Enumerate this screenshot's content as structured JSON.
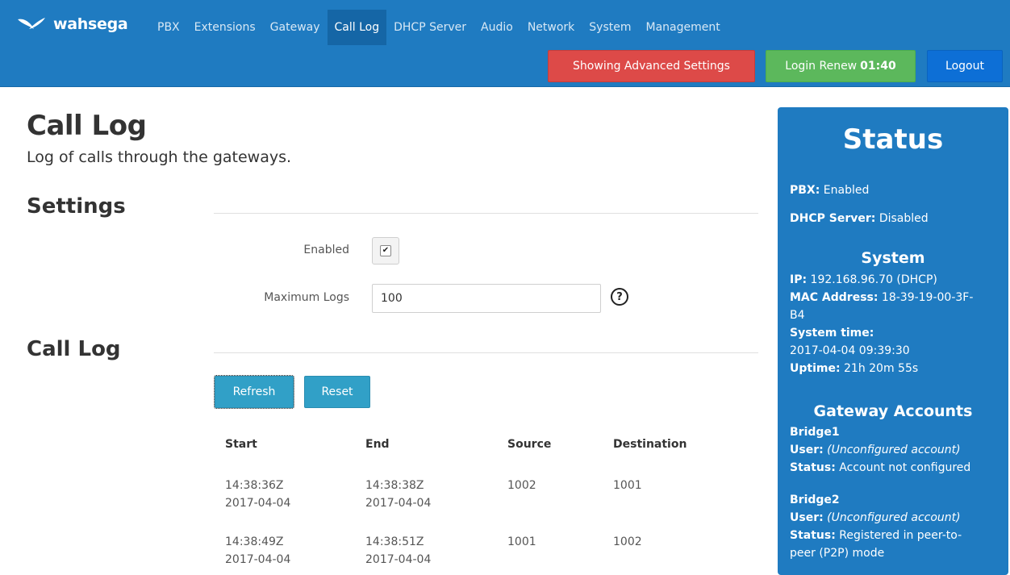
{
  "brand": {
    "name": "wahsega"
  },
  "nav": {
    "items": [
      "PBX",
      "Extensions",
      "Gateway",
      "Call Log",
      "DHCP Server",
      "Audio",
      "Network",
      "System",
      "Management"
    ],
    "active": "Call Log",
    "advanced_label": "Showing Advanced Settings",
    "renew_label": "Login Renew",
    "renew_timer": "01:40",
    "logout_label": "Logout"
  },
  "page": {
    "title": "Call Log",
    "subtitle": "Log of calls through the gateways."
  },
  "settings": {
    "heading": "Settings",
    "enabled_label": "Enabled",
    "enabled_checked": true,
    "max_logs_label": "Maximum Logs",
    "max_logs_value": "100",
    "help_glyph": "?"
  },
  "call_log": {
    "heading": "Call Log",
    "refresh_label": "Refresh",
    "reset_label": "Reset",
    "columns": [
      "Start",
      "End",
      "Source",
      "Destination"
    ],
    "rows": [
      {
        "start_time": "14:38:36Z",
        "start_date": "2017-04-04",
        "end_time": "14:38:38Z",
        "end_date": "2017-04-04",
        "source": "1002",
        "destination": "1001"
      },
      {
        "start_time": "14:38:49Z",
        "start_date": "2017-04-04",
        "end_time": "14:38:51Z",
        "end_date": "2017-04-04",
        "source": "1001",
        "destination": "1002"
      }
    ]
  },
  "status": {
    "title": "Status",
    "pbx_label": "PBX:",
    "pbx_value": "Enabled",
    "dhcp_label": "DHCP Server:",
    "dhcp_value": "Disabled",
    "system_heading": "System",
    "ip_label": "IP:",
    "ip_value": "192.168.96.70 (DHCP)",
    "mac_label": "MAC Address:",
    "mac_value_line1": "18-39-19-00-3F-",
    "mac_value_line2": "B4",
    "time_label": "System time:",
    "time_value": "2017-04-04 09:39:30",
    "uptime_label": "Uptime:",
    "uptime_value": "21h 20m 55s",
    "gateway_heading": "Gateway Accounts",
    "bridges": [
      {
        "name": "Bridge1",
        "user_label": "User:",
        "user_value": "(Unconfigured account)",
        "status_label": "Status:",
        "status_value_line1": "Account not configured",
        "status_value_line2": ""
      },
      {
        "name": "Bridge2",
        "user_label": "User:",
        "user_value": "(Unconfigured account)",
        "status_label": "Status:",
        "status_value_line1": "Registered in peer-to-",
        "status_value_line2": "peer (P2P) mode"
      }
    ]
  },
  "colors": {
    "navbar": "#1f7bc1",
    "nav_active": "#1566a6",
    "advanced": "#dd4a48",
    "renew": "#5cb85c",
    "logout": "#0d6fd6",
    "action_button": "#31a0c7",
    "status_panel": "#1f7bc1"
  }
}
